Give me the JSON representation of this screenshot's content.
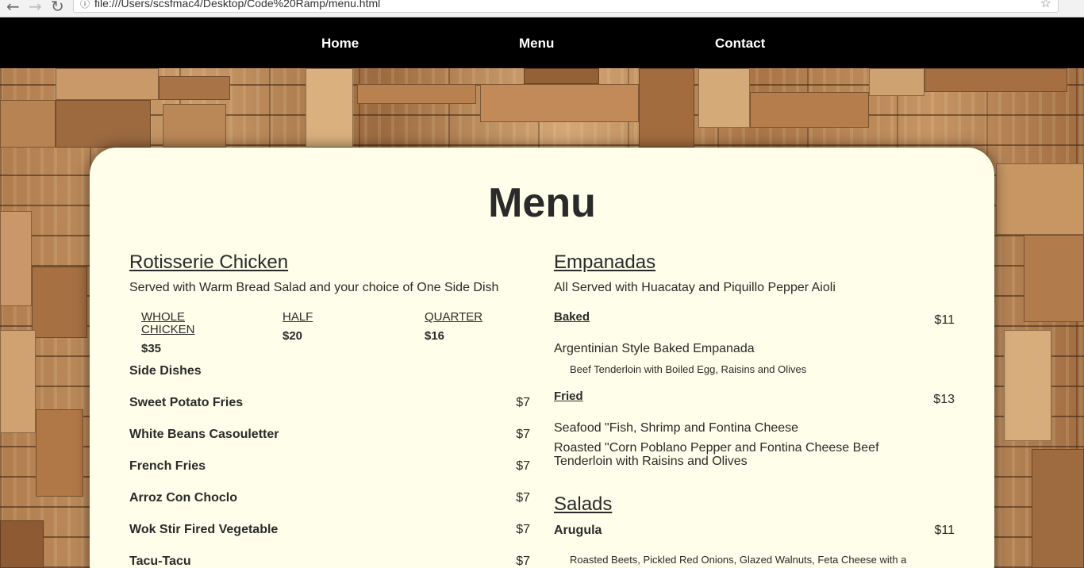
{
  "browser": {
    "url": "file:///Users/scsfmac4/Desktop/Code%20Ramp/menu.html"
  },
  "nav": {
    "home": "Home",
    "menu": "Menu",
    "contact": "Contact"
  },
  "page_title": "Menu",
  "chicken": {
    "heading": "Rotisserie Chicken",
    "subtitle": "Served with Warm Bread Salad and your choice of One Side Dish",
    "sizes": [
      {
        "label_line1": "WHOLE",
        "label_line2": "CHICKEN",
        "price": "$35"
      },
      {
        "label_line1": "HALF",
        "label_line2": "",
        "price": "$20"
      },
      {
        "label_line1": "QUARTER",
        "label_line2": "",
        "price": "$16"
      }
    ]
  },
  "sides": {
    "heading": "Side Dishes",
    "items": [
      {
        "name": "Sweet Potato Fries",
        "price": "$7"
      },
      {
        "name": "White Beans Casouletter",
        "price": "$7"
      },
      {
        "name": "French Fries",
        "price": "$7"
      },
      {
        "name": "Arroz Con Choclo",
        "price": "$7"
      },
      {
        "name": "Wok Stir Fired Vegetable",
        "price": "$7"
      },
      {
        "name": "Tacu-Tacu",
        "price": "$7"
      }
    ]
  },
  "empanadas": {
    "heading": "Empanadas",
    "subtitle": "All Served with Huacatay and Piquillo Pepper Aioli",
    "baked": {
      "label": "Baked",
      "price": "$11",
      "item": "Argentinian Style Baked Empanada",
      "desc": "Beef Tenderloin with Boiled Egg, Raisins and Olives"
    },
    "fried": {
      "label": "Fried",
      "price": "$13",
      "item1": "Seafood \"Fish, Shrimp and Fontina Cheese",
      "item2_line1": "Roasted \"Corn Poblano Pepper and Fontina Cheese Beef",
      "item2_line2": "Tenderloin with Raisins and Olives"
    }
  },
  "salads": {
    "heading": "Salads",
    "arugula": {
      "name": "Arugula",
      "price": "$11",
      "desc": "Roasted Beets, Pickled Red Onions, Glazed Walnuts, Feta Cheese with a"
    }
  }
}
